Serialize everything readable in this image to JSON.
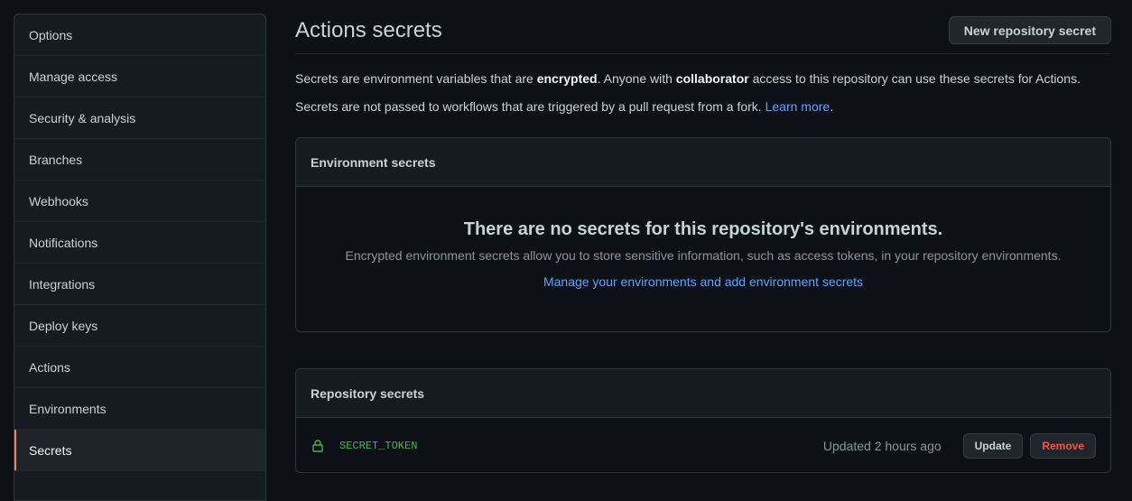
{
  "sidebar": {
    "items": [
      {
        "label": "Options"
      },
      {
        "label": "Manage access"
      },
      {
        "label": "Security & analysis"
      },
      {
        "label": "Branches"
      },
      {
        "label": "Webhooks"
      },
      {
        "label": "Notifications"
      },
      {
        "label": "Integrations"
      },
      {
        "label": "Deploy keys"
      },
      {
        "label": "Actions"
      },
      {
        "label": "Environments"
      },
      {
        "label": "Secrets",
        "selected": true
      }
    ]
  },
  "header": {
    "title": "Actions secrets",
    "new_secret_button": "New repository secret"
  },
  "description": {
    "line1_part1": "Secrets are environment variables that are ",
    "line1_bold1": "encrypted",
    "line1_part2": ". Anyone with ",
    "line1_bold2": "collaborator",
    "line1_part3": " access to this repository can use these secrets for Actions.",
    "line2_text": "Secrets are not passed to workflows that are triggered by a pull request from a fork. ",
    "line2_link": "Learn more",
    "line2_end": "."
  },
  "environment_secrets": {
    "header": "Environment secrets",
    "empty_title": "There are no secrets for this repository's environments.",
    "empty_desc": "Encrypted environment secrets allow you to store sensitive information, such as access tokens, in your repository environments.",
    "manage_link": "Manage your environments and add environment secrets"
  },
  "repository_secrets": {
    "header": "Repository secrets",
    "rows": [
      {
        "icon": "lock-icon",
        "name": "SECRET_TOKEN",
        "updated": "Updated 2 hours ago",
        "update_label": "Update",
        "remove_label": "Remove"
      }
    ]
  },
  "colors": {
    "background": "#0d1117",
    "panel": "#161b22",
    "border": "#30363d",
    "link": "#58a6ff",
    "secret_name": "#3fb950",
    "danger": "#f85149",
    "selected_indicator": "#f78166"
  }
}
